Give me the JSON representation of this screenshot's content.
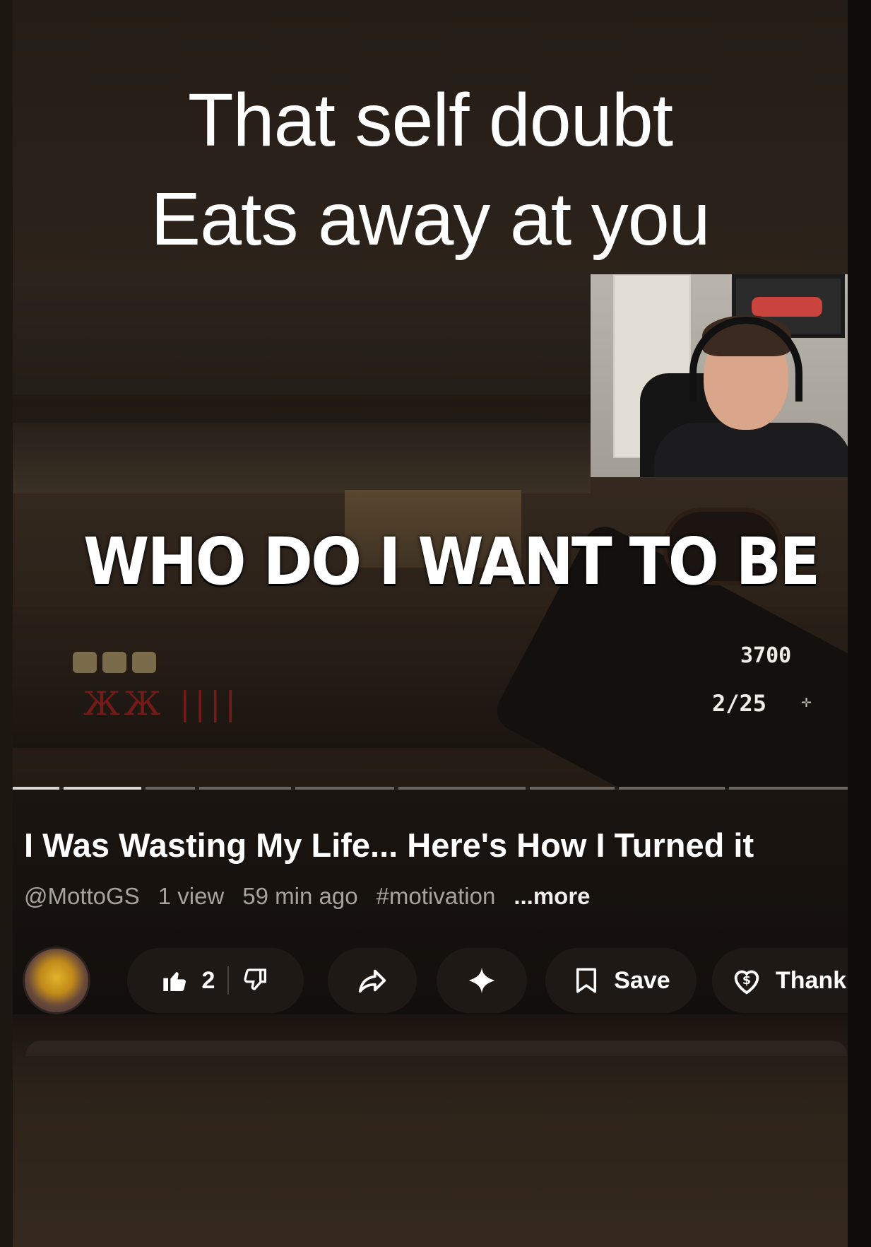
{
  "overlay_caption": {
    "line1": "That self doubt",
    "line2": "Eats away at you"
  },
  "video": {
    "title_overlay": "WHO DO I WANT TO BE",
    "hud_score": "3700",
    "hud_ammo": "2/25",
    "progress_fraction": 0.17
  },
  "details": {
    "title": "I Was Wasting My Life... Here's How I Turned it",
    "channel": "@MottoGS",
    "views": "1 view",
    "age": "59 min ago",
    "hashtag": "#motivation",
    "more": "...more"
  },
  "actions": {
    "like_count": "2",
    "save_label": "Save",
    "thanks_label": "Thank"
  },
  "icons": {
    "like": "thumbs-up-icon",
    "dislike": "thumbs-down-icon",
    "share": "share-icon",
    "remix": "sparkle-icon",
    "save": "bookmark-icon",
    "thanks": "heart-dollar-icon"
  },
  "colors": {
    "background": "#2a2119",
    "pill": "#1f1916",
    "meta_text": "#a7a29d",
    "text": "#ffffff"
  }
}
